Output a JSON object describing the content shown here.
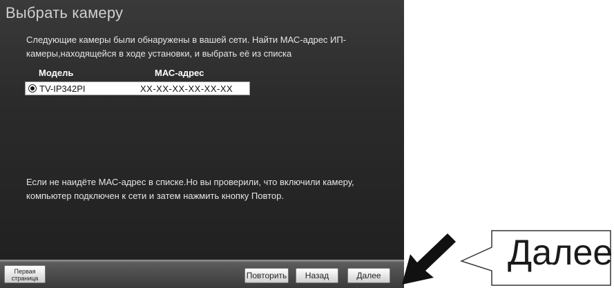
{
  "window": {
    "title": "Выбрать камеру",
    "intro_line1": "Следующие камеры были обнаружены в вашей сети. Найти МАС-адрес ИП-",
    "intro_line2": "камеры,находящейся в ходе установки, и выбрать её из списка"
  },
  "camera_table": {
    "headers": {
      "model": "Модель",
      "mac": "МАС-адрес"
    },
    "rows": [
      {
        "model": "TV-IP342PI",
        "mac": "XX-XX-XX-XX-XX-XX",
        "selected": true
      }
    ]
  },
  "note": {
    "line1": "Если не наидёте МАС-адрес в списке.Но вы проверили, что включили камеру,",
    "line2": "компьютер подключен к сети и затем нажмить кнопку Повтор."
  },
  "footer": {
    "first_page_line1": "Первая",
    "first_page_line2": "страница",
    "retry_label": "Повторить",
    "back_label": "Назад",
    "next_label": "Далее"
  },
  "callout": {
    "label": "Далее",
    "arrow_icon": "arrow-down-left-icon"
  },
  "colors": {
    "window_bg": "#2b2b2b",
    "text": "#e6e6e6",
    "title": "#cfcfcf"
  }
}
